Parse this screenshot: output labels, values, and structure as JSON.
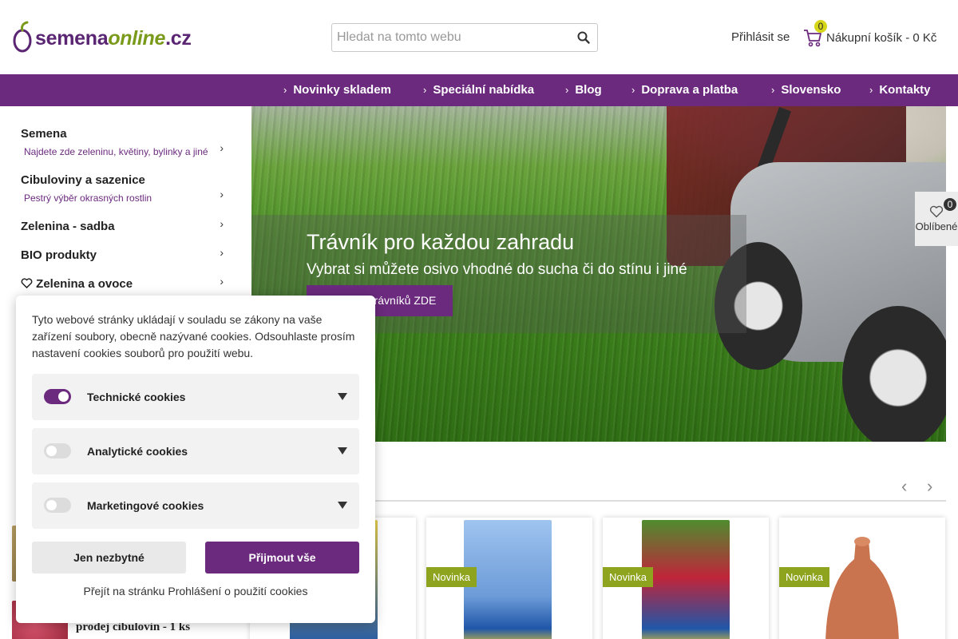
{
  "header": {
    "logo": {
      "text_main": "semena",
      "text_online": "online",
      "text_tld": ".cz"
    },
    "search": {
      "placeholder": "Hledat na tomto webu",
      "value": "",
      "icon": "search-icon"
    },
    "login_label": "Přihlásit se",
    "cart": {
      "count": "0",
      "label": "Nákupní košík - 0 Kč",
      "icon": "cart-icon"
    }
  },
  "nav": {
    "items": [
      {
        "label": "Novinky skladem"
      },
      {
        "label": "Speciální nabídka"
      },
      {
        "label": "Blog"
      },
      {
        "label": "Doprava a platba"
      },
      {
        "label": "Slovensko"
      },
      {
        "label": "Kontakty"
      }
    ]
  },
  "sidebar": {
    "categories": [
      {
        "title": "Semena",
        "subtitle": "Najdete zde zeleninu, květiny, bylinky a jiné"
      },
      {
        "title": "Cibuloviny a sazenice",
        "subtitle": "Pestrý výběr okrasných rostlin"
      },
      {
        "title": "Zelenina - sadba",
        "subtitle": ""
      },
      {
        "title": "BIO produkty",
        "subtitle": ""
      },
      {
        "title": "Zelenina a ovoce",
        "subtitle": "",
        "icon": "heart-icon"
      }
    ]
  },
  "hero": {
    "title": "Trávník pro každou zahradu",
    "subtitle": "Vybrat si můžete osivo vhodné do sucha či do stínu i jiné",
    "button_label": "trávníků ZDE"
  },
  "favorites": {
    "count": "0",
    "label": "Oblíbené",
    "icon": "heart-icon"
  },
  "products": {
    "badge": "Novinka",
    "side_item_text": "prodej cibulovin - 1 ks",
    "cards": [
      {
        "badge": ""
      },
      {
        "badge": "Novinka"
      },
      {
        "badge": "Novinka"
      },
      {
        "badge": "Novinka"
      }
    ]
  },
  "cookie": {
    "text": "Tyto webové stránky ukládají v souladu se zákony na vaše zařízení soubory, obecně nazývané cookies. Odsouhlaste prosím nastavení cookies souborů pro použití webu.",
    "categories": [
      {
        "label": "Technické cookies",
        "enabled": true
      },
      {
        "label": "Analytické cookies",
        "enabled": false
      },
      {
        "label": "Marketingové cookies",
        "enabled": false
      }
    ],
    "btn_necessary": "Jen nezbytné",
    "btn_accept": "Přijmout vše",
    "link": "Přejít na stránku Prohlášení o použití cookies"
  },
  "colors": {
    "brand_purple": "#6b2a7e",
    "brand_green": "#8ea31e",
    "badge_yellow": "#d6d619"
  }
}
